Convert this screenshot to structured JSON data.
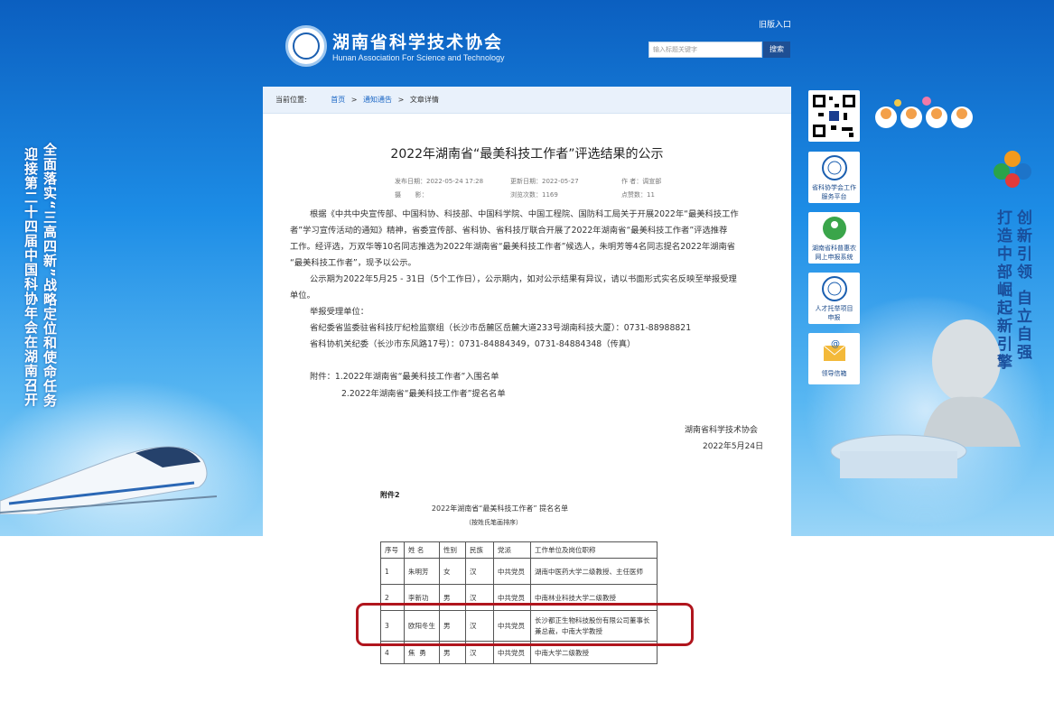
{
  "header": {
    "site_title": "湖南省科学技术协会",
    "site_subtitle": "Hunan Association For Science and Technology",
    "old_entry": "旧版入口",
    "search_placeholder": "输入标题关键字",
    "search_label": "搜索"
  },
  "side_banners": {
    "left_line1": "全面落实“三高四新”战略定位和使命任务",
    "left_line2": "迎接第二十四届中国科协年会在湖南召开",
    "right_line1": "创新引领 自立自强",
    "right_line2": "打造中部崛起新引擎"
  },
  "breadcrumb": {
    "prefix": "当前位置:",
    "home": "首页",
    "sep1": ">",
    "section": "通知通告",
    "sep2": ">",
    "current": "文章详情"
  },
  "article": {
    "title": "2022年湖南省“最美科技工作者”评选结果的公示",
    "meta": {
      "publish": "发布日期：2022-05-24 17:28",
      "update": "更新日期：2022-05-27",
      "author": "作    者：调宣部",
      "photo": "摄       影：",
      "views": "浏览次数：1169",
      "likes": "点赞数：11"
    },
    "p1_l1": "根据《中共中央宣传部、中国科协、科技部、中国科学院、中国工程院、国防科工局关于开展2022年“最美科技工作",
    "p1_l2": "者”学习宣传活动的通知》精神，省委宣传部、省科协、省科技厅联合开展了2022年湖南省“最美科技工作者”评选推荐",
    "p1_l3": "工作。经评选，万双华等10名同志推选为2022年湖南省“最美科技工作者”候选人，朱明芳等4名同志提名2022年湖南省",
    "p1_l4": "“最美科技工作者”，现予以公示。",
    "p2_l1": "公示期为2022年5月25 - 31日（5个工作日），公示期内，如对公示结果有异议，请以书面形式实名反映至举报受理",
    "p2_l2": "单位。",
    "p3": "举报受理单位：",
    "p4": "省纪委省监委驻省科技厅纪检监察组（长沙市岳麓区岳麓大道233号湖南科技大厦）：0731-88988821",
    "p5": "省科协机关纪委（长沙市东风路17号）：0731-84884349，0731-84884348（传真）",
    "attach1": "附件：1.2022年湖南省“最美科技工作者”入围名单",
    "attach2": "2.2022年湖南省“最美科技工作者”提名名单",
    "sign_org": "湖南省科学技术协会",
    "sign_date": "2022年5月24日"
  },
  "attachment": {
    "label": "附件2",
    "title": "2022年湖南省“最美科技工作者” 提名名单",
    "note": "（按姓氏笔画排序）",
    "headers": [
      "序号",
      "姓  名",
      "性别",
      "民族",
      "党派",
      "工作单位及岗位职称"
    ],
    "rows": [
      [
        "1",
        "朱明芳",
        "女",
        "汉",
        "中共党员",
        "湖南中医药大学二级教授、主任医师"
      ],
      [
        "2",
        "李新功",
        "男",
        "汉",
        "中共党员",
        "中南林业科技大学二级教授"
      ],
      [
        "3",
        "欧阳冬生",
        "男",
        "汉",
        "中共党员",
        "长沙都正生物科技股份有限公司董事长兼总裁，中南大学教授"
      ],
      [
        "4",
        "焦  勇",
        "男",
        "汉",
        "中共党员",
        "中南大学二级教授"
      ]
    ]
  },
  "right_links": {
    "link1": "省科协学会工作服务平台",
    "link2": "湖南省科普惠农网上申报系统",
    "link3": "人才托举项目申报",
    "link4": "领导信箱"
  },
  "colors": {
    "highlight": "#b0151d",
    "brand_blue": "#1e4f94"
  }
}
